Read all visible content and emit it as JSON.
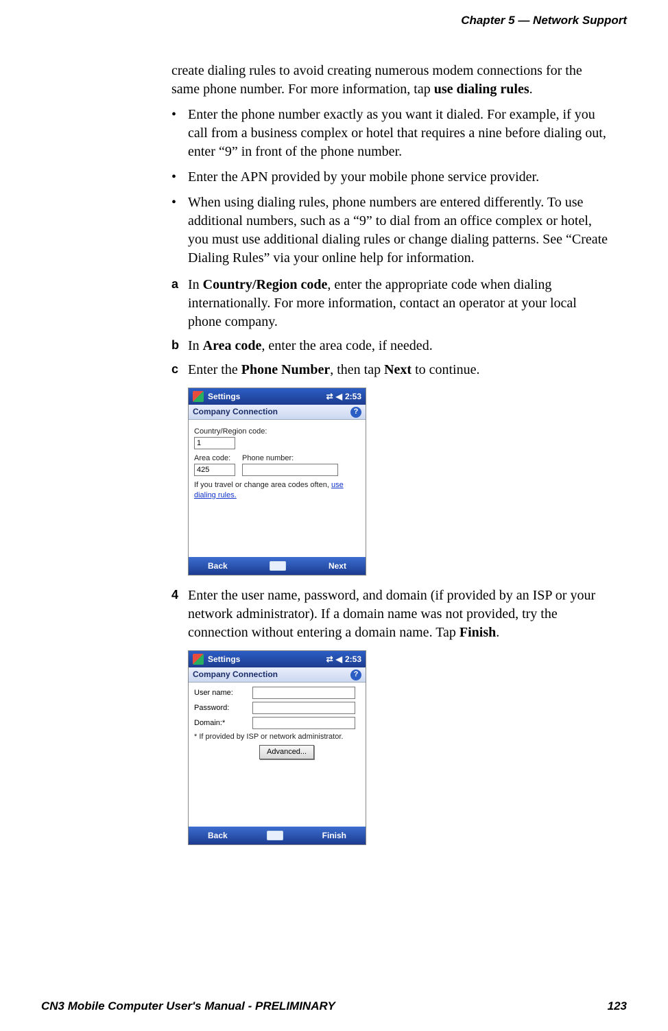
{
  "header": {
    "chapter": "Chapter 5 —  Network Support"
  },
  "body": {
    "intro_1": "create dialing rules to avoid creating numerous modem connections for the same phone number. For more information, tap ",
    "intro_1_bold": "use dialing rules",
    "intro_1_end": ".",
    "bullets": [
      "Enter the phone number exactly as you want it dialed. For example, if you call from a business complex or hotel that requires a nine before dialing out, enter “9” in front of the phone number.",
      "Enter the APN provided by your mobile phone service provider.",
      "When using dialing rules, phone numbers are entered differently. To use additional numbers, such as a “9” to dial from an office complex or hotel, you must use additional dialing rules or change dialing patterns. See “Create Dialing Rules” via your online help for information."
    ],
    "step_a_1": "In ",
    "step_a_bold": "Country/Region code",
    "step_a_2": ", enter the appropriate code when dialing internationally. For more information, contact an operator at your local phone company.",
    "step_b_1": "In ",
    "step_b_bold": "Area code",
    "step_b_2": ", enter the area code, if needed.",
    "step_c_1": "Enter the ",
    "step_c_bold1": "Phone Number",
    "step_c_2": ", then tap ",
    "step_c_bold2": "Next",
    "step_c_3": " to continue.",
    "step4_1": "Enter the user name, password, and domain (if provided by an ISP or your network administrator). If a domain name was not provided, try the connection without entering a domain name. Tap ",
    "step4_bold": "Finish",
    "step4_2": "."
  },
  "screenshot1": {
    "titlebar": "Settings",
    "time": "2:53",
    "subtitle": "Company Connection",
    "country_label": "Country/Region code:",
    "country_value": "1",
    "area_label": "Area code:",
    "area_value": "425",
    "phone_label": "Phone number:",
    "phone_value": "",
    "note_1": "If you travel or change area codes often, ",
    "note_link": "use dialing rules.",
    "back": "Back",
    "next": "Next"
  },
  "screenshot2": {
    "titlebar": "Settings",
    "time": "2:53",
    "subtitle": "Company Connection",
    "user_label": "User name:",
    "pass_label": "Password:",
    "domain_label": "Domain:*",
    "note": "* If provided by ISP or network administrator.",
    "advanced": "Advanced...",
    "back": "Back",
    "finish": "Finish"
  },
  "footer": {
    "left": "CN3 Mobile Computer User's Manual - PRELIMINARY",
    "right": "123"
  },
  "markers": {
    "a": "a",
    "b": "b",
    "c": "c",
    "four": "4"
  }
}
